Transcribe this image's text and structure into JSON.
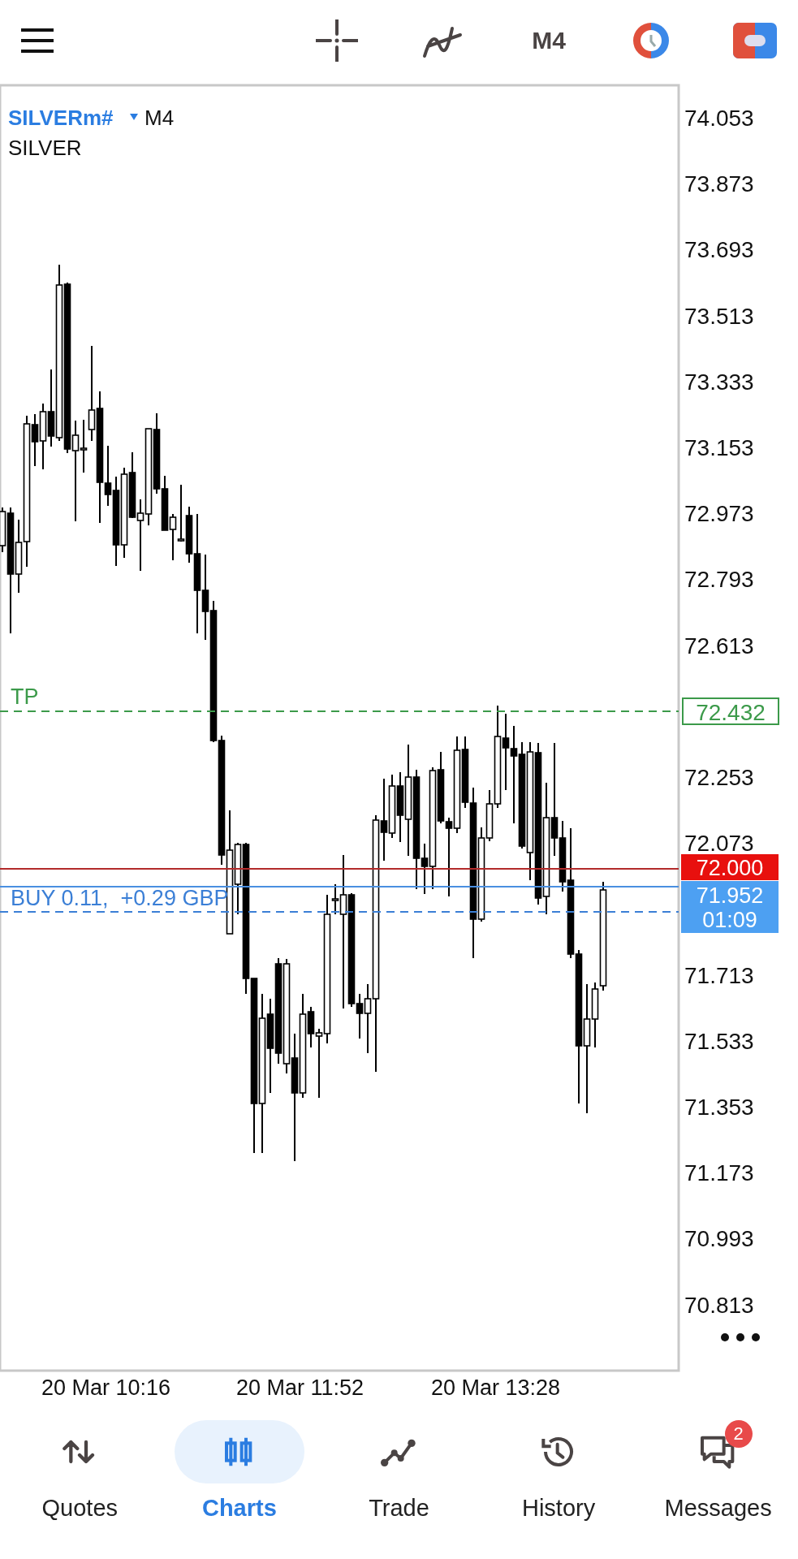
{
  "toolbar": {
    "timeframe": "M4"
  },
  "chart": {
    "symbol": "SILVERm#",
    "timeframe": "M4",
    "description": "SILVER",
    "price_labels": [
      "74.053",
      "73.873",
      "73.693",
      "73.513",
      "73.333",
      "73.153",
      "72.973",
      "72.793",
      "72.613",
      "72.253",
      "72.073",
      "71.713",
      "71.533",
      "71.353",
      "71.173",
      "70.993",
      "70.813"
    ],
    "time_labels": [
      "20 Mar 10:16",
      "20 Mar 11:52",
      "20 Mar 13:28"
    ],
    "take_profit": {
      "label": "TP",
      "price_tag": "72.432"
    },
    "position": {
      "label": "BUY 0.11,  +0.29 GBP"
    },
    "ask_tag": "72.000",
    "bid_tag": "71.952",
    "countdown": "01:09"
  },
  "nav": [
    {
      "label": "Quotes",
      "selected": false
    },
    {
      "label": "Charts",
      "selected": true
    },
    {
      "label": "Trade",
      "selected": false
    },
    {
      "label": "History",
      "selected": false
    },
    {
      "label": "Messages",
      "selected": false,
      "badge": "2"
    }
  ]
}
